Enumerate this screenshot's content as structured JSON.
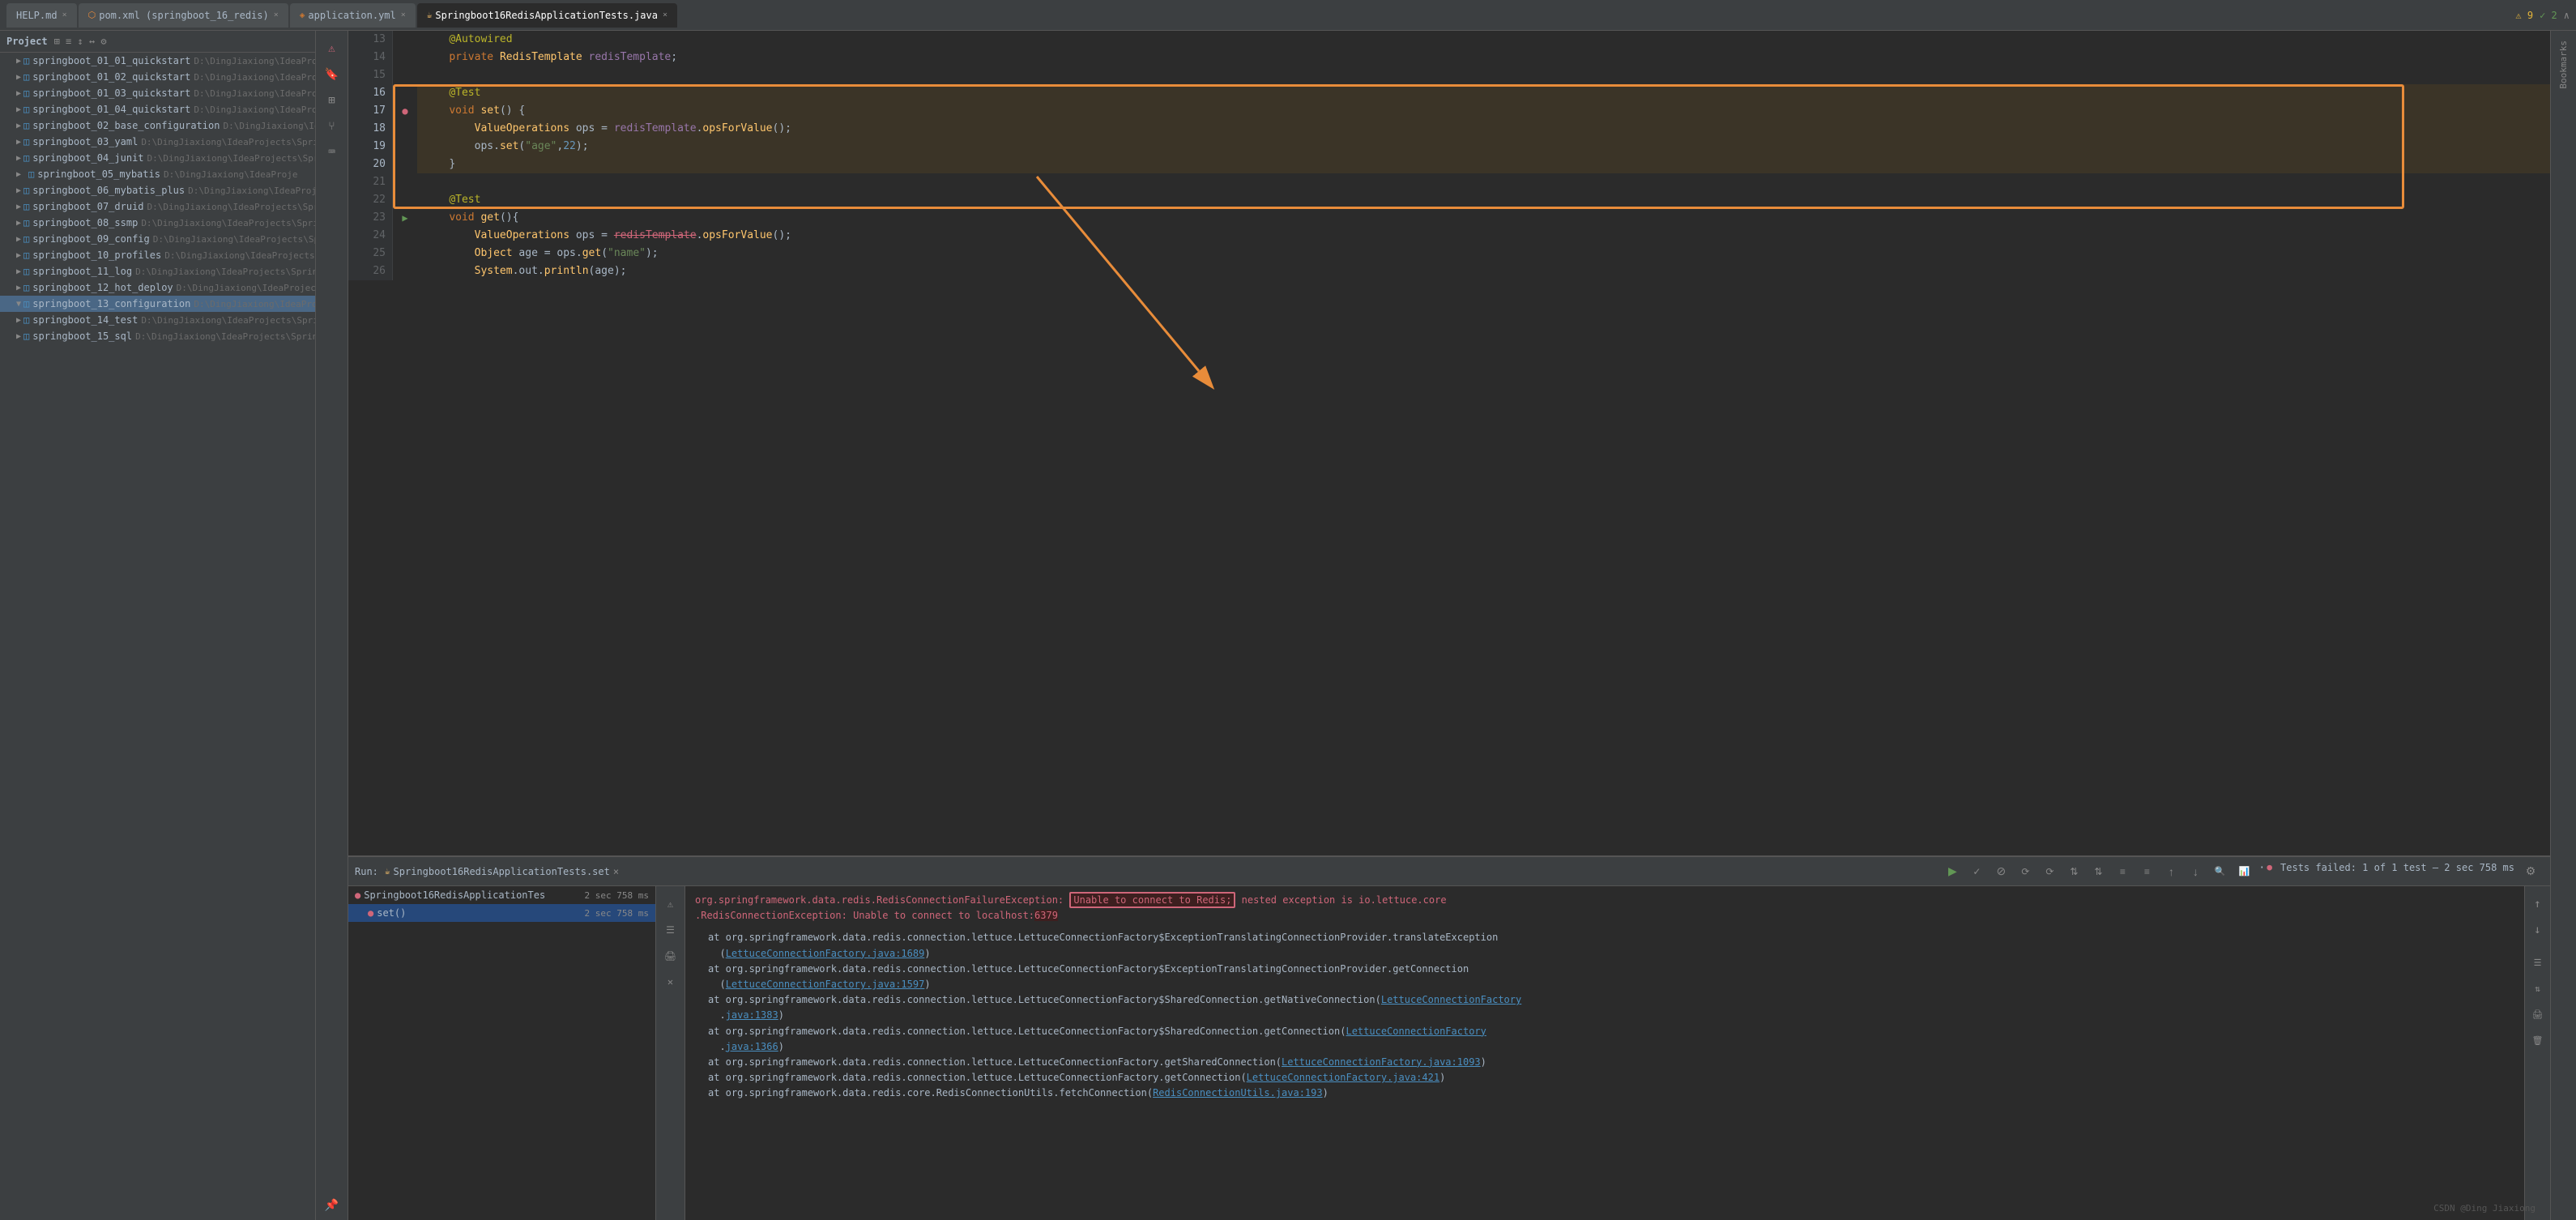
{
  "tabs": [
    {
      "id": "help",
      "label": "HELP.md",
      "active": false,
      "closable": true
    },
    {
      "id": "pom",
      "label": "pom.xml (springboot_16_redis)",
      "active": false,
      "closable": true
    },
    {
      "id": "application",
      "label": "application.yml",
      "active": false,
      "closable": true
    },
    {
      "id": "test",
      "label": "Springboot16RedisApplicationTests.java",
      "active": true,
      "closable": true
    }
  ],
  "sidebar": {
    "header": "Project",
    "items": [
      {
        "name": "springboot_01_01_quickstart",
        "path": "D:\\DingJiaxiong\\IdeaProje",
        "indent": 1,
        "expanded": false
      },
      {
        "name": "springboot_01_02_quickstart",
        "path": "D:\\DingJiaxiong\\IdeaProje",
        "indent": 1,
        "expanded": false
      },
      {
        "name": "springboot_01_03_quickstart",
        "path": "D:\\DingJiaxiong\\IdeaProje",
        "indent": 1,
        "expanded": false
      },
      {
        "name": "springboot_01_04_quickstart",
        "path": "D:\\DingJiaxiong\\IdeaProje",
        "indent": 1,
        "expanded": false
      },
      {
        "name": "springboot_02_base_configuration",
        "path": "D:\\DingJiaxiong\\Idea",
        "indent": 1,
        "expanded": false
      },
      {
        "name": "springboot_03_yaml",
        "path": "D:\\DingJiaxiong\\IdeaProjects\\Spring",
        "indent": 1,
        "expanded": false
      },
      {
        "name": "springboot_04_junit",
        "path": "D:\\DingJiaxiong\\IdeaProjects\\Spring",
        "indent": 1,
        "expanded": false
      },
      {
        "name": "springboot_05_mybatis",
        "path": "D:\\DingJiaxiong\\IdeaProje",
        "indent": 1,
        "expanded": false
      },
      {
        "name": "springboot_06_mybatis_plus",
        "path": "D:\\DingJiaxiong\\IdeaProje",
        "indent": 1,
        "expanded": false
      },
      {
        "name": "springboot_07_druid",
        "path": "D:\\DingJiaxiong\\IdeaProjects\\Spring",
        "indent": 1,
        "expanded": false
      },
      {
        "name": "springboot_08_ssmp",
        "path": "D:\\DingJiaxiong\\IdeaProjects\\Spring",
        "indent": 1,
        "expanded": false
      },
      {
        "name": "springboot_09_config",
        "path": "D:\\DingJiaxiong\\IdeaProjects\\Spri",
        "indent": 1,
        "expanded": false
      },
      {
        "name": "springboot_10_profiles",
        "path": "D:\\DingJiaxiong\\IdeaProjects\\Spr",
        "indent": 1,
        "expanded": false
      },
      {
        "name": "springboot_11_log",
        "path": "D:\\DingJiaxiong\\IdeaProjects\\SpringB",
        "indent": 1,
        "expanded": false
      },
      {
        "name": "springboot_12_hot_deploy",
        "path": "D:\\DingJiaxiong\\IdeaProjects\\Spr",
        "indent": 1,
        "expanded": false
      },
      {
        "name": "springboot_13_configuration",
        "path": "D:\\DingJiaxiong\\IdeaProje",
        "indent": 1,
        "selected": true,
        "expanded": true
      },
      {
        "name": "springboot_14_test",
        "path": "D:\\DingJiaxiong\\IdeaProjects\\SpringB",
        "indent": 1,
        "expanded": false
      },
      {
        "name": "springboot_15_sql",
        "path": "D:\\DingJiaxiong\\IdeaProjects\\SpringB",
        "indent": 1,
        "expanded": false
      }
    ]
  },
  "editor": {
    "lines": [
      {
        "num": 13,
        "content": "    @Autowired",
        "type": "annotation_line"
      },
      {
        "num": 14,
        "content": "    private RedisTemplate redisTemplate;",
        "type": "code"
      },
      {
        "num": 15,
        "content": "",
        "type": "empty"
      },
      {
        "num": 16,
        "content": "    @Test",
        "type": "annotation",
        "highlighted": true
      },
      {
        "num": 17,
        "content": "    void set() {",
        "type": "code",
        "highlighted": true,
        "hasError": true
      },
      {
        "num": 18,
        "content": "        ValueOperations ops = redisTemplate.opsForValue();",
        "type": "code",
        "highlighted": true
      },
      {
        "num": 19,
        "content": "        ops.set(\"age\",22);",
        "type": "code",
        "highlighted": true
      },
      {
        "num": 20,
        "content": "    }",
        "type": "code",
        "highlighted": true
      },
      {
        "num": 21,
        "content": "",
        "type": "empty"
      },
      {
        "num": 22,
        "content": "    @Test",
        "type": "annotation"
      },
      {
        "num": 23,
        "content": "    void get(){",
        "type": "code",
        "hasRun": true
      },
      {
        "num": 24,
        "content": "        ValueOperations ops = redisTemplate.opsForValue();",
        "type": "code"
      },
      {
        "num": 25,
        "content": "        Object age = ops.get(\"name\");",
        "type": "code"
      },
      {
        "num": 26,
        "content": "        System.out.println(age);",
        "type": "code"
      }
    ]
  },
  "run_panel": {
    "tab_label": "Run:",
    "config_name": "Springboot16RedisApplicationTests.set",
    "close_label": "×",
    "status": "Tests failed: 1 of 1 test – 2 sec 758 ms",
    "test_tree": [
      {
        "name": "Springboot16RedisApplicationTes",
        "duration": "2 sec 758 ms",
        "status": "fail",
        "expanded": true
      },
      {
        "name": "set()",
        "duration": "2 sec 758 ms",
        "status": "fail",
        "indent": 1,
        "selected": true
      }
    ],
    "output": {
      "error_line1": "org.springframework.data.redis.RedisConnectionFailureException: Unable to connect to Redis; nested exception is io.lettuce.core",
      "error_line2": ".RedisConnectionException: Unable to connect to localhost:6379",
      "stack_lines": [
        "at org.springframework.data.redis.connection.lettuce.LettuceConnectionFactory$ExceptionTranslatingConnectionProvider.translateException",
        "(LettuceConnectionFactory.java:1689)",
        "at org.springframework.data.redis.connection.lettuce.LettuceConnectionFactory$ExceptionTranslatingConnectionProvider.getConnection",
        "(LettuceConnectionFactory.java:1597)",
        "at org.springframework.data.redis.connection.lettuce.LettuceConnectionFactory$SharedConnection.getNativeConnection(LettuceConnectionFactory",
        ".java:1383)",
        "at org.springframework.data.redis.connection.lettuce.LettuceConnectionFactory$SharedConnection.getConnection(LettuceConnectionFactory",
        ".java:1366)",
        "at org.springframework.data.redis.connection.lettuce.LettuceConnectionFactory.getSharedConnection(LettuceConnectionFactory.java:1093)",
        "at org.springframework.data.redis.connection.lettuce.LettuceConnectionFactory.getConnection(LettuceConnectionFactory.java:421)",
        "at org.springframework.data.redis.core.RedisConnectionUtils.fetchConnection(RedisConnectionUtils.java:193)"
      ]
    }
  },
  "icons": {
    "run": "▶",
    "stop": "■",
    "rerun": "↺",
    "check": "✓",
    "cross": "✕",
    "arrow_down": "▼",
    "arrow_right": "▶",
    "gear": "⚙",
    "chevron_down": "∧",
    "chevron_up": "∨"
  },
  "watermark": "CSDN @Ding Jiaxiong",
  "top_right": {
    "warnings": "⚠ 9",
    "errors": "✓ 2"
  }
}
